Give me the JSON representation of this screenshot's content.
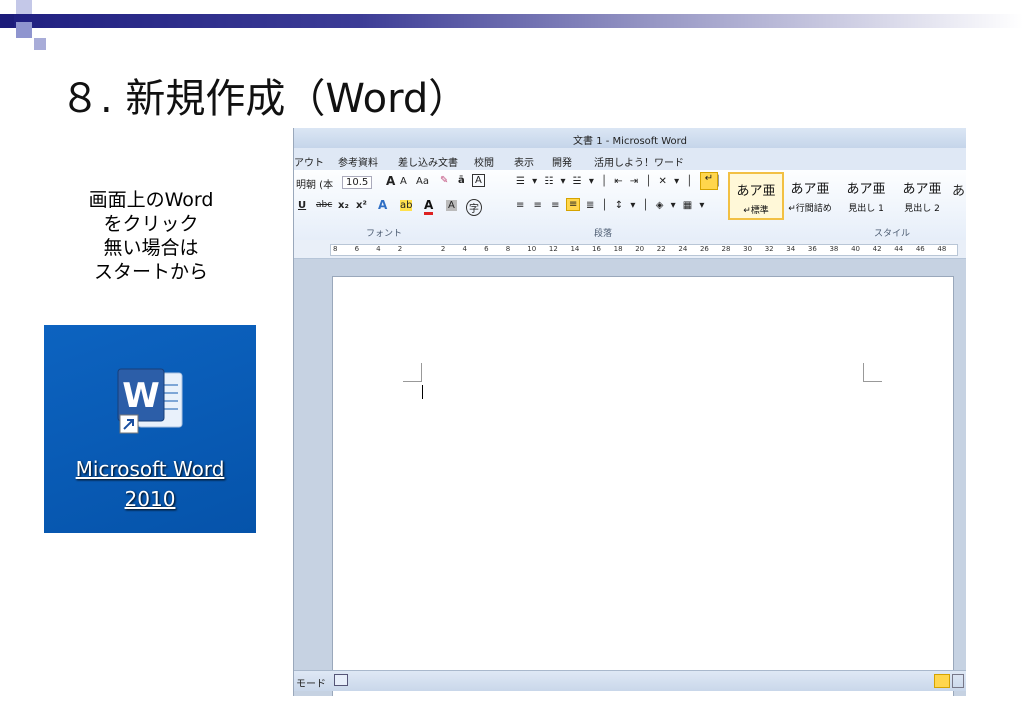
{
  "slide": {
    "title": "８. 新規作成（Word）",
    "instructions": [
      "画面上のWord",
      "をクリック",
      "無い場合は",
      "スタートから"
    ]
  },
  "desktop_icon": {
    "icon": "word-2010-icon",
    "label_line1": "Microsoft Word",
    "label_line2": "2010",
    "background": "#0a5cb4"
  },
  "word_window": {
    "title": "文書 1 - Microsoft Word",
    "tabs": [
      "アウト",
      "参考資料",
      "差し込み文書",
      "校閲",
      "表示",
      "開発",
      "活用しよう！ワード"
    ],
    "font": {
      "name": "明朝 (本",
      "size": "10.5"
    },
    "groups": {
      "font": "フォント",
      "paragraph": "段落",
      "styles": "スタイル"
    },
    "styles": [
      {
        "preview": "あア亜",
        "name": "↵標準"
      },
      {
        "preview": "あア亜",
        "name": "↵行間詰め"
      },
      {
        "preview": "あア亜",
        "name": "見出し 1"
      },
      {
        "preview": "あア亜",
        "name": "見出し 2"
      }
    ],
    "style_partial": "あ",
    "ruler_ticks": [
      "8",
      "6",
      "4",
      "2",
      "",
      "2",
      "4",
      "6",
      "8",
      "10",
      "12",
      "14",
      "16",
      "18",
      "20",
      "22",
      "24",
      "26",
      "28",
      "30",
      "32",
      "34",
      "36",
      "38",
      "40",
      "42",
      "44",
      "46",
      "48"
    ],
    "status_mode": "モード"
  }
}
